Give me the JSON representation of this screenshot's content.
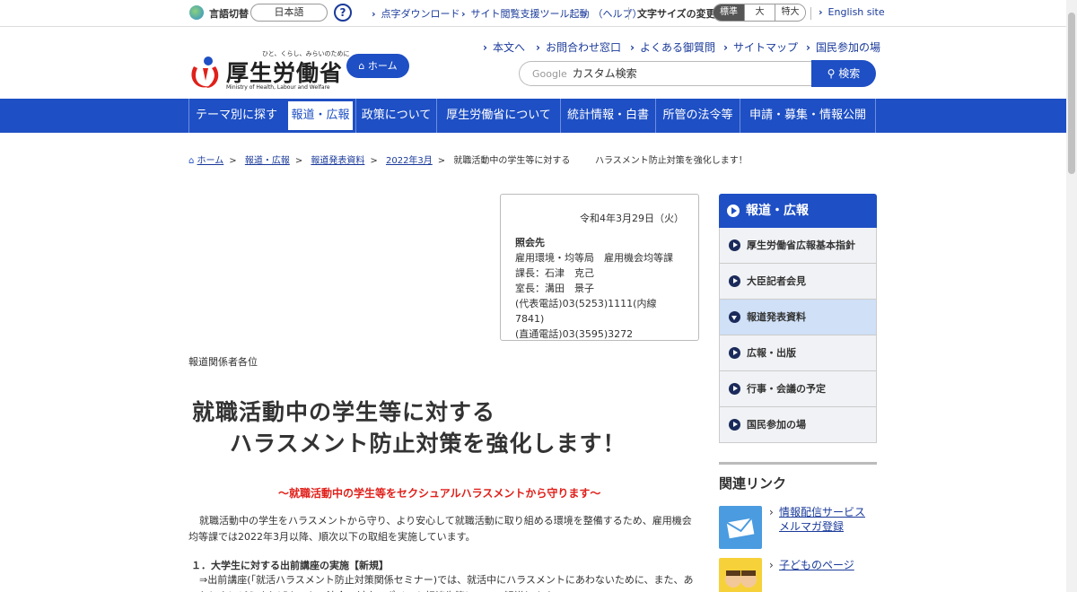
{
  "utility": {
    "lang_label": "言語切替",
    "lang_value": "日本語",
    "help": "?",
    "braille": "点字ダウンロード",
    "reader": "サイト閲覧支援ツール起動",
    "help_link": "（ヘルプ）",
    "fontsize_label": "文字サイズの変更",
    "fontsizes": [
      "標準",
      "大",
      "特大"
    ],
    "english": "English site"
  },
  "header": {
    "tagline": "ひと、くらし、みらいのために",
    "logo": "厚生労働省",
    "logo_en": "Ministry of Health, Labour and Welfare",
    "home": "ホーム",
    "links": [
      "本文へ",
      "お問合わせ窓口",
      "よくある御質問",
      "サイトマップ",
      "国民参加の場"
    ],
    "search_google": "Google",
    "search_placeholder": "カスタム検索",
    "search_btn": "検索"
  },
  "nav": [
    "テーマ別に探す",
    "報道・広報",
    "政策について",
    "厚生労働省について",
    "統計情報・白書",
    "所管の法令等",
    "申請・募集・情報公開"
  ],
  "breadcrumb": {
    "items": [
      "ホーム",
      "報道・広報",
      "報道発表資料",
      "2022年3月"
    ],
    "current": "就職活動中の学生等に対する",
    "current_tail": "ハラスメント防止対策を強化します！"
  },
  "press": {
    "date": "令和4年3月29日（火）",
    "contact_head": "照会先",
    "dept": "雇用環境・均等局　雇用機会均等課",
    "chief": "課長：石津　克己",
    "head": "室長：溝田　景子",
    "tel1": "(代表電話)03(5253)1111(内線7841)",
    "tel2": "(直通電話)03(3595)3272"
  },
  "article": {
    "addressee": "報道関係者各位",
    "title_line1": "就職活動中の学生等に対する",
    "title_line2": "ハラスメント防止対策を強化します！",
    "subtitle": "～就職活動中の学生等をセクシュアルハラスメントから守ります～",
    "intro": "就職活動中の学生をハラスメントから守り、より安心して就職活動に取り組める環境を整備するため、雇用機会均等課では2022年3月以降、順次以下の取組を実施しています。",
    "sec1_head": "１．大学生に対する出前講座の実施【新規】",
    "sec1_body": "⇒出前講座(「就活ハラスメント防止対策関係セミナー)では、就活中にハラスメントにあわないために、また、あったときにどうすればよいか、法令・対応のポイント相談先等について解説します。"
  },
  "side": {
    "head": "報道・広報",
    "items": [
      "厚生労働省広報基本指針",
      "大臣記者会見",
      "報道発表資料",
      "広報・出版",
      "行事・会議の予定",
      "国民参加の場"
    ],
    "related_head": "関連リンク",
    "related": [
      "情報配信サービスメルマガ登録",
      "子どものページ"
    ]
  }
}
